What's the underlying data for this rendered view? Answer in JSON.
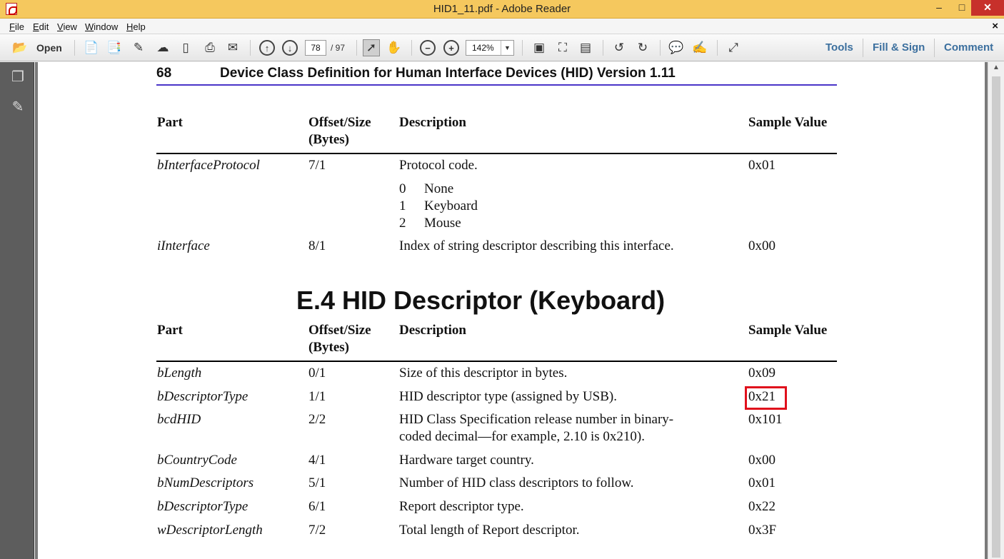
{
  "window": {
    "title": "HID1_11.pdf - Adobe Reader",
    "minimize": "–",
    "maximize": "□",
    "close": "✕"
  },
  "menu": {
    "items": [
      "File",
      "Edit",
      "View",
      "Window",
      "Help"
    ],
    "close": "×"
  },
  "toolbar": {
    "open_label": "Open",
    "page_current": "78",
    "page_total": "/ 97",
    "zoom": "142%",
    "tools": "Tools",
    "fill_sign": "Fill & Sign",
    "comment": "Comment"
  },
  "document": {
    "page_number": "68",
    "running_header": "Device Class Definition for Human Interface Devices (HID) Version 1.11",
    "table1": {
      "headers": {
        "part": "Part",
        "offset_1": "Offset/Size",
        "offset_2": "(Bytes)",
        "description": "Description",
        "sample": "Sample Value"
      },
      "rows": [
        {
          "part": "bInterfaceProtocol",
          "offset": "7/1",
          "description": "Protocol code.",
          "sample": "0x01"
        },
        {
          "part": "iInterface",
          "offset": "8/1",
          "description": "Index of string descriptor describing this interface.",
          "sample": "0x00"
        }
      ],
      "protocol_codes": [
        {
          "code": "0",
          "label": "None"
        },
        {
          "code": "1",
          "label": "Keyboard"
        },
        {
          "code": "2",
          "label": "Mouse"
        }
      ]
    },
    "section_title": "E.4 HID Descriptor (Keyboard)",
    "table2": {
      "headers": {
        "part": "Part",
        "offset_1": "Offset/Size",
        "offset_2": "(Bytes)",
        "description": "Description",
        "sample": "Sample Value"
      },
      "rows": [
        {
          "part": "bLength",
          "offset": "0/1",
          "description": "Size of this descriptor in bytes.",
          "sample": "0x09"
        },
        {
          "part": "bDescriptorType",
          "offset": "1/1",
          "description": "HID descriptor type (assigned by USB).",
          "sample": "0x21"
        },
        {
          "part": "bcdHID",
          "offset": "2/2",
          "description": "HID Class Specification release number in binary-",
          "description_2": "coded decimal—for example, 2.10 is 0x210).",
          "sample": "0x101"
        },
        {
          "part": "bCountryCode",
          "offset": "4/1",
          "description": "Hardware target country.",
          "sample": "0x00"
        },
        {
          "part": "bNumDescriptors",
          "offset": "5/1",
          "description": "Number of HID class descriptors to follow.",
          "sample": "0x01"
        },
        {
          "part": "bDescriptorType",
          "offset": "6/1",
          "description": "Report descriptor type.",
          "sample": "0x22"
        },
        {
          "part": "wDescriptorLength",
          "offset": "7/2",
          "description": "Total length of Report descriptor.",
          "sample": "0x3F"
        }
      ]
    }
  },
  "colors": {
    "titlebar": "#f5c85e",
    "header_rule": "#4a35c8",
    "highlight": "#e0101c",
    "link": "#3b6f9e"
  }
}
